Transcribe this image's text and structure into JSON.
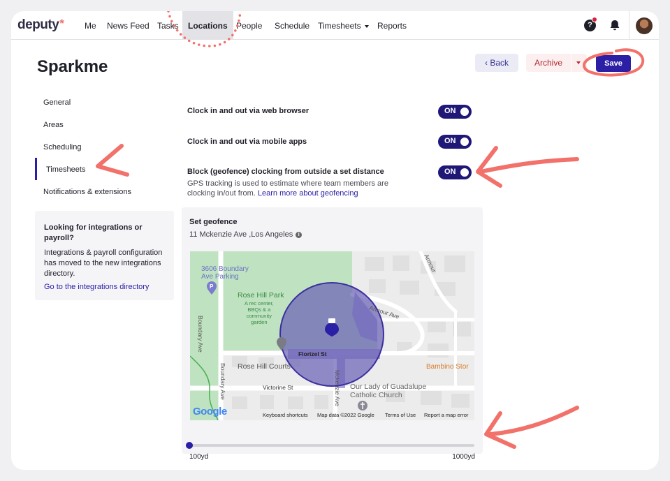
{
  "brand": {
    "logo": "deputy",
    "logo_star": "*"
  },
  "nav": {
    "items": [
      {
        "label": "Me"
      },
      {
        "label": "News Feed"
      },
      {
        "label": "Tasks"
      },
      {
        "label": "Locations",
        "active": true
      },
      {
        "label": "People"
      },
      {
        "label": "Schedule"
      },
      {
        "label": "Timesheets",
        "has_dropdown": true
      },
      {
        "label": "Reports"
      }
    ],
    "help_icon": "?"
  },
  "page": {
    "title": "Sparkme"
  },
  "actions": {
    "back": "Back",
    "archive": "Archive",
    "save": "Save"
  },
  "sidebar": {
    "items": [
      {
        "label": "General"
      },
      {
        "label": "Areas"
      },
      {
        "label": "Scheduling"
      },
      {
        "label": "Timesheets",
        "active": true
      },
      {
        "label": "Notifications & extensions"
      }
    ],
    "promo": {
      "title": "Looking for integrations or payroll?",
      "text": "Integrations & payroll configuration has moved to the new integrations directory.",
      "link": "Go to the integrations directory"
    }
  },
  "settings": [
    {
      "label": "Clock in and out via web browser",
      "toggle": "ON"
    },
    {
      "label": "Clock in and out via mobile apps",
      "toggle": "ON"
    },
    {
      "label": "Block (geofence) clocking from outside a set distance",
      "toggle": "ON",
      "help": "GPS tracking is used to estimate where team members are clocking in/out from.",
      "help_link": "Learn more about geofencing"
    }
  ],
  "geofence": {
    "title": "Set geofence",
    "address": "11 Mckenzie Ave ,Los Angeles",
    "info_icon": "i",
    "slider": {
      "min_label": "100yd",
      "max_label": "1000yd",
      "value_fraction": 0.0
    },
    "map": {
      "labels": {
        "place1": "3606 Boundary",
        "place1b": "Ave Parking",
        "park": "Rose Hill Park",
        "park_desc1": "A rec center,",
        "park_desc2": "BBQs & a",
        "park_desc3": "community",
        "park_desc4": "garden",
        "street_armour_ave": "Armour Ave",
        "street_armour": "Armour",
        "street_boundary1": "Boundary Ave",
        "street_boundary2": "Boundary Ave",
        "street_florizel": "Florizel St",
        "courts": "Rose Hill Courts",
        "street_victorine": "Victorine St",
        "street_mckenzie": "Mckenzie Ave",
        "church1": "Our Lady of Guadalupe",
        "church2": "Catholic Church",
        "bambino": "Bambino Stor"
      },
      "google": "Google",
      "footer": {
        "shortcuts": "Keyboard shortcuts",
        "mapdata": "Map data ©2022 Google",
        "terms": "Terms of Use",
        "report": "Report a map error"
      }
    }
  },
  "colors": {
    "primary": "#2a1fa5",
    "toggle_on": "#1f1877",
    "annotation": "#f2716a",
    "archive": "#b22a32",
    "geofence_fill": "#6b63b5"
  }
}
